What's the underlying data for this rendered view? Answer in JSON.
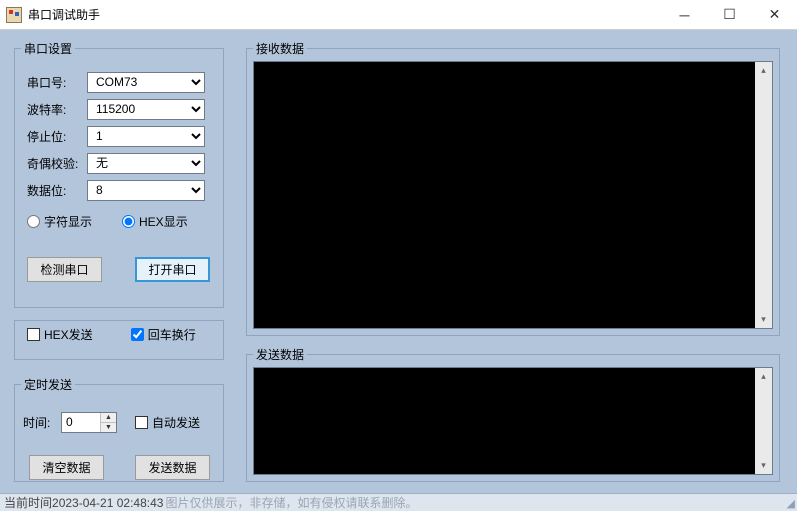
{
  "window": {
    "title": "串口调试助手"
  },
  "port_settings": {
    "legend": "串口设置",
    "port_label": "串口号:",
    "port_value": "COM73",
    "baud_label": "波特率:",
    "baud_value": "115200",
    "stop_label": "停止位:",
    "stop_value": "1",
    "parity_label": "奇偶校验:",
    "parity_value": "无",
    "data_label": "数据位:",
    "data_value": "8",
    "radio_char": "字符显示",
    "radio_hex": "HEX显示",
    "btn_detect": "检测串口",
    "btn_open": "打开串口"
  },
  "send_opts": {
    "chk_hex": "HEX发送",
    "chk_crlf": "回车换行"
  },
  "timer": {
    "legend": "定时发送",
    "time_label": "时间:",
    "time_value": "0",
    "chk_auto": "自动发送",
    "btn_clear": "清空数据",
    "btn_send": "发送数据"
  },
  "recv": {
    "legend": "接收数据"
  },
  "send": {
    "legend": "发送数据"
  },
  "status": {
    "time_label": "当前时间",
    "time_value": "2023-04-21 02:48:43",
    "watermark": "图片仅供展示，非存储，如有侵权请联系删除。"
  }
}
